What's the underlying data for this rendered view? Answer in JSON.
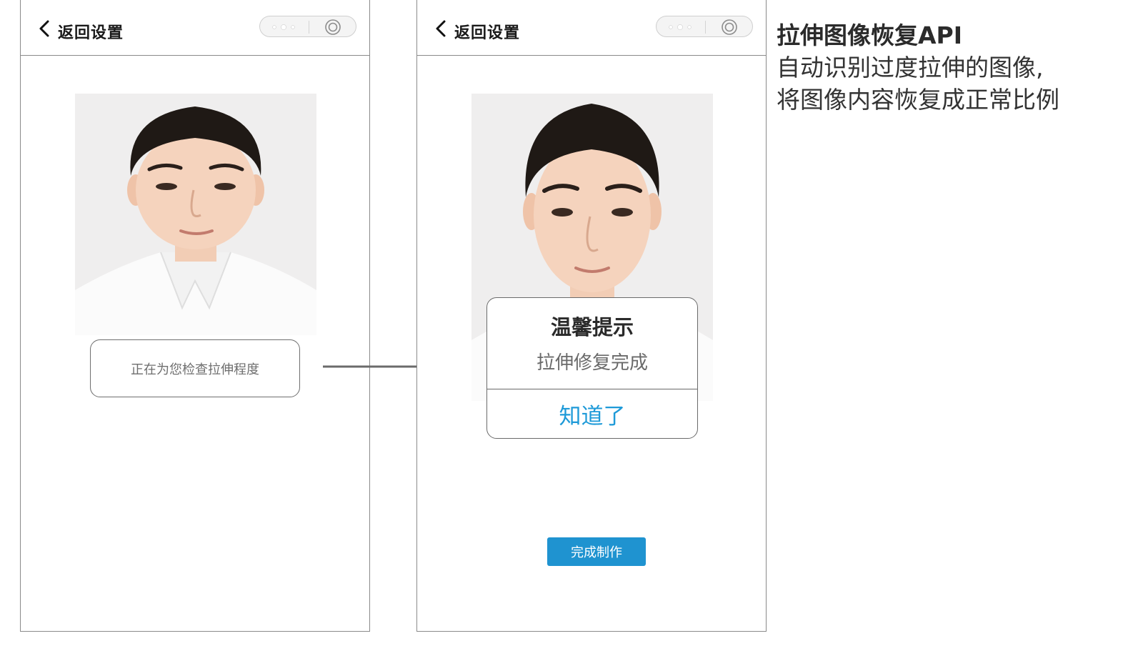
{
  "left_phone": {
    "header": {
      "title": "返回设置",
      "back_icon": "chevron-left-icon"
    },
    "status_text": "正在为您检查拉伸程度"
  },
  "right_phone": {
    "header": {
      "title": "返回设置",
      "back_icon": "chevron-left-icon"
    },
    "dialog": {
      "title": "温馨提示",
      "message": "拉伸修复完成",
      "button_label": "知道了"
    },
    "finish_button_label": "完成制作"
  },
  "description": {
    "title": "拉伸图像恢复API",
    "line1": "自动识别过度拉伸的图像,",
    "line2": "将图像内容恢复成正常比例"
  },
  "colors": {
    "accent": "#1f93d0",
    "dialog_button_text": "#1e9ad8",
    "frame_border": "#8a8a8a",
    "arrow": "#6b6b6b"
  }
}
